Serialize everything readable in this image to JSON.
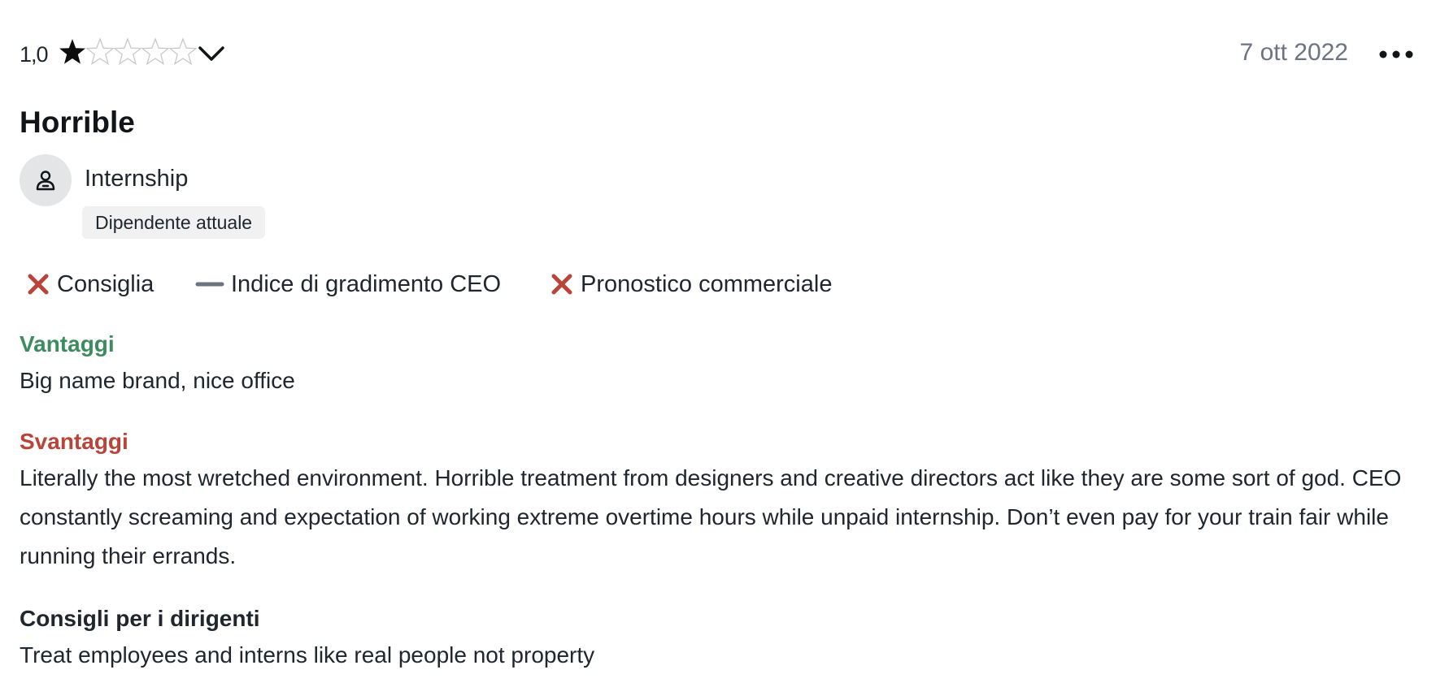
{
  "review": {
    "rating_value": "1,0",
    "rating": 1,
    "rating_max": 5,
    "date": "7 ott 2022",
    "title": "Horrible",
    "author": {
      "job_title": "Internship",
      "status_badge": "Dipendente attuale"
    },
    "indicators": [
      {
        "label": "Consiglia",
        "icon": "x-icon",
        "color": "#b9443a"
      },
      {
        "label": "Indice di gradimento CEO",
        "icon": "dash-icon",
        "color": "#6b7480"
      },
      {
        "label": "Pronostico commerciale",
        "icon": "x-icon",
        "color": "#b9443a"
      }
    ],
    "pros": {
      "heading": "Vantaggi",
      "text": "Big name brand, nice office",
      "color": "#3d8c5f"
    },
    "cons": {
      "heading": "Svantaggi",
      "text": "Literally the most wretched environment. Horrible treatment from designers and creative directors act like they are some sort of god. CEO constantly screaming and expectation of working extreme overtime hours while unpaid internship. Don’t even pay for your train fair while running their errands.",
      "color": "#b9443a"
    },
    "advice": {
      "heading": "Consigli per i dirigenti",
      "text": "Treat employees and interns like real people not property"
    }
  }
}
